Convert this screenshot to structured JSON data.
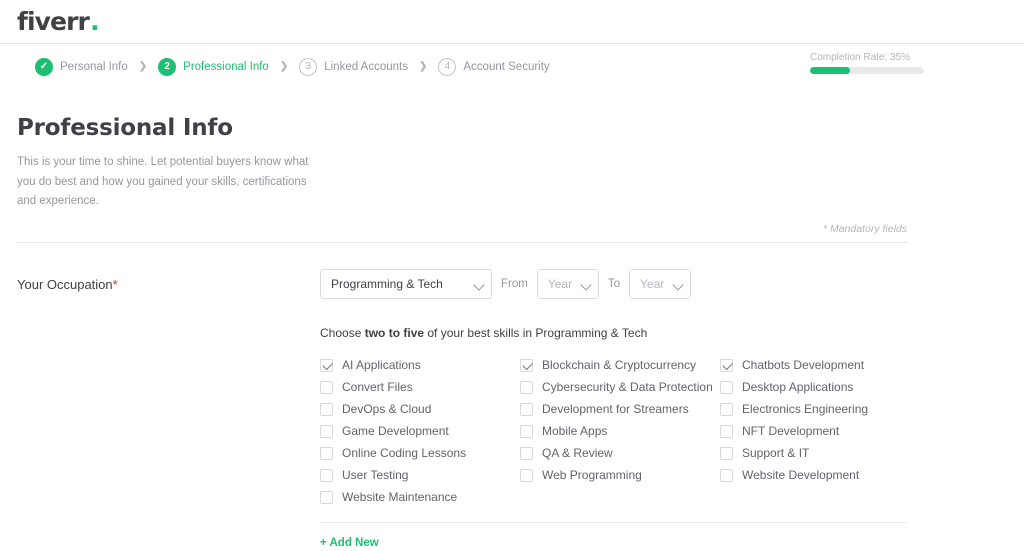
{
  "brand": {
    "logo_text": "fiverr",
    "logo_dot": ".",
    "accent_color": "#1dbf73",
    "text_color": "#404145"
  },
  "stepper": {
    "separator": "❯",
    "steps": [
      {
        "marker": "✓",
        "label": "Personal Info",
        "state": "done"
      },
      {
        "marker": "2",
        "label": "Professional Info",
        "state": "current"
      },
      {
        "marker": "3",
        "label": "Linked Accounts",
        "state": "todo"
      },
      {
        "marker": "4",
        "label": "Account Security",
        "state": "todo"
      }
    ]
  },
  "completion": {
    "label": "Completion Rate: 35%",
    "percent": 35
  },
  "page": {
    "title": "Professional Info",
    "description": "This is your time to shine. Let potential buyers know what you do best and how you gained your skills, certifications and experience.",
    "mandatory_note": "* Mandatory fields"
  },
  "occupation": {
    "label": "Your Occupation",
    "required_mark": "*",
    "category_value": "Programming & Tech",
    "from_label": "From",
    "from_value": "Year",
    "to_label": "To",
    "to_value": "Year"
  },
  "skills": {
    "hint_prefix": "Choose ",
    "hint_bold": "two to five",
    "hint_suffix": " of your best skills in Programming & Tech",
    "add_new_label": "+ Add New",
    "columns": [
      [
        {
          "label": "AI Applications",
          "checked": true
        },
        {
          "label": "Convert Files",
          "checked": false
        },
        {
          "label": "DevOps & Cloud",
          "checked": false
        },
        {
          "label": "Game Development",
          "checked": false
        },
        {
          "label": "Online Coding Lessons",
          "checked": false
        },
        {
          "label": "User Testing",
          "checked": false
        },
        {
          "label": "Website Maintenance",
          "checked": false
        }
      ],
      [
        {
          "label": "Blockchain & Cryptocurrency",
          "checked": true
        },
        {
          "label": "Cybersecurity & Data Protection",
          "checked": false
        },
        {
          "label": "Development for Streamers",
          "checked": false
        },
        {
          "label": "Mobile Apps",
          "checked": false
        },
        {
          "label": "QA & Review",
          "checked": false
        },
        {
          "label": "Web Programming",
          "checked": false
        }
      ],
      [
        {
          "label": "Chatbots Development",
          "checked": true
        },
        {
          "label": "Desktop Applications",
          "checked": false
        },
        {
          "label": "Electronics Engineering",
          "checked": false
        },
        {
          "label": "NFT Development",
          "checked": false
        },
        {
          "label": "Support & IT",
          "checked": false
        },
        {
          "label": "Website Development",
          "checked": false
        }
      ]
    ]
  }
}
